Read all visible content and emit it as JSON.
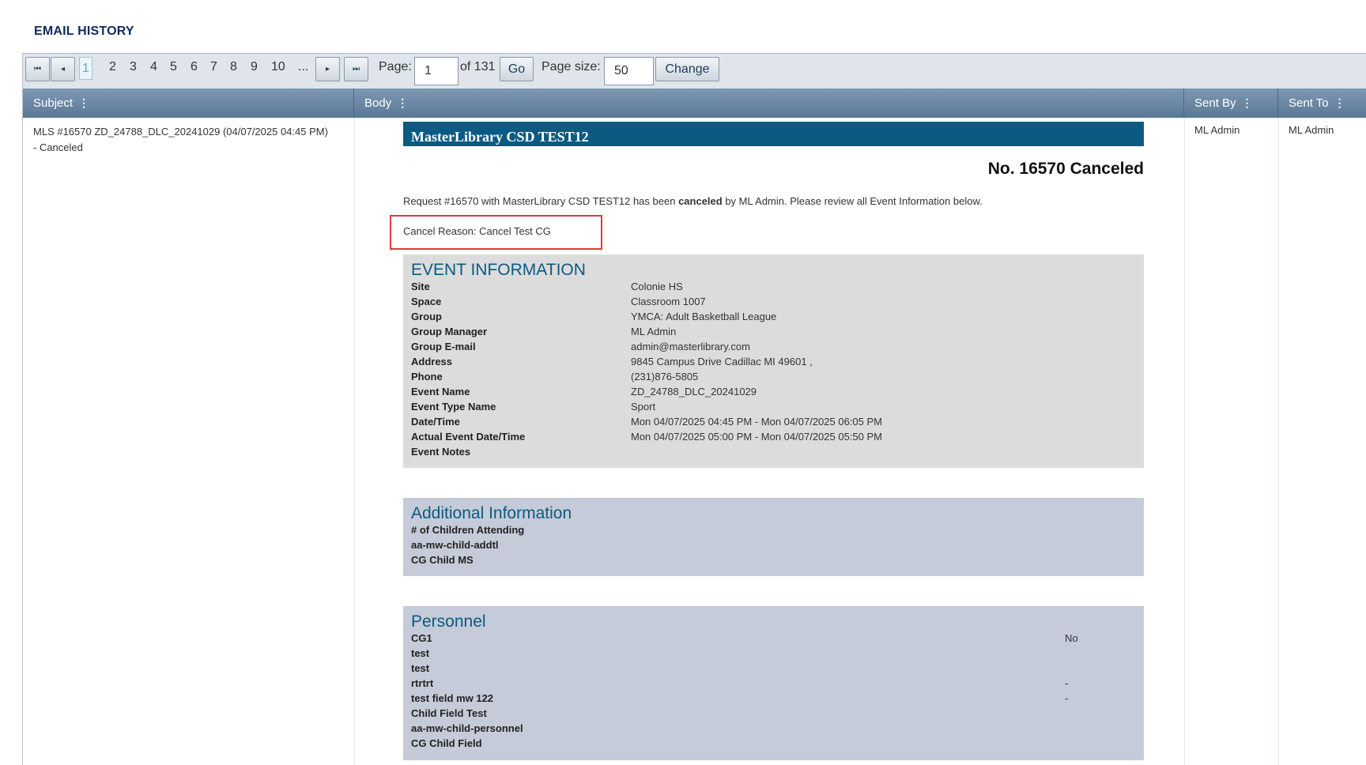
{
  "page_title": "EMAIL HISTORY",
  "pager": {
    "first_icon": "⏮",
    "prev_icon": "◂",
    "next_icon": "▸",
    "last_icon": "⏭",
    "pages": [
      "1",
      "2",
      "3",
      "4",
      "5",
      "6",
      "7",
      "8",
      "9",
      "10",
      "..."
    ],
    "current_page": "1",
    "page_label": "Page:",
    "page_value": "1",
    "of_label": "of 131",
    "go_label": "Go",
    "size_label": "Page size:",
    "size_value": "50",
    "change_label": "Change"
  },
  "columns": {
    "subject": "Subject",
    "body": "Body",
    "sent_by": "Sent By",
    "sent_to": "Sent To",
    "menu_icon": "⋮"
  },
  "row": {
    "subject": "MLS #16570 ZD_24788_DLC_20241029 (04/07/2025 04:45 PM) - Canceled",
    "sent_by": "ML Admin",
    "sent_to": "ML Admin"
  },
  "email": {
    "banner": "MasterLibrary CSD TEST12",
    "request_number": "No. 16570 Canceled",
    "message_pre": "Request #16570 with MasterLibrary CSD TEST12 has been ",
    "message_bold": "canceled",
    "message_post": " by ML Admin. Please review all Event Information below.",
    "cancel_reason": "Cancel Reason: Cancel Test CG",
    "event_info": {
      "title": "EVENT INFORMATION",
      "fields": [
        {
          "label": "Site",
          "value": "Colonie HS"
        },
        {
          "label": "Space",
          "value": "Classroom 1007"
        },
        {
          "label": "Group",
          "value": "YMCA: Adult Basketball League"
        },
        {
          "label": "Group Manager",
          "value": "ML Admin"
        },
        {
          "label": "Group E-mail",
          "value": "admin@masterlibrary.com"
        },
        {
          "label": "Address",
          "value": "9845 Campus Drive Cadillac MI 49601 ,"
        },
        {
          "label": "Phone",
          "value": "(231)876-5805"
        },
        {
          "label": "Event Name",
          "value": "ZD_24788_DLC_20241029"
        },
        {
          "label": "Event Type Name",
          "value": "Sport"
        },
        {
          "label": "Date/Time",
          "value": "Mon 04/07/2025 04:45 PM - Mon 04/07/2025 06:05 PM"
        },
        {
          "label": "Actual Event Date/Time",
          "value": "Mon 04/07/2025 05:00 PM - Mon 04/07/2025 05:50 PM"
        },
        {
          "label": "Event Notes",
          "value": ""
        }
      ]
    },
    "additional_info": {
      "title": "Additional Information",
      "fields": [
        {
          "label": "# of Children Attending",
          "value": ""
        },
        {
          "label": "aa-mw-child-addtl",
          "value": ""
        },
        {
          "label": "CG Child MS",
          "value": ""
        }
      ]
    },
    "personnel": {
      "title": "Personnel",
      "fields": [
        {
          "label": "CG1",
          "value": "No"
        },
        {
          "label": "test",
          "value": ""
        },
        {
          "label": "test",
          "value": ""
        },
        {
          "label": "rtrtrt",
          "value": "-"
        },
        {
          "label": "test field mw 122",
          "value": "-"
        },
        {
          "label": "Child Field Test",
          "value": ""
        },
        {
          "label": "aa-mw-child-personnel",
          "value": ""
        },
        {
          "label": "CG Child Field",
          "value": ""
        }
      ]
    }
  },
  "colors": {
    "header_bg": "#6b88a5",
    "banner_bg": "#0b5a82",
    "event_bg": "#dcdcdc",
    "section_bg": "#c5cbd8",
    "highlight_border": "#e03a3a"
  }
}
